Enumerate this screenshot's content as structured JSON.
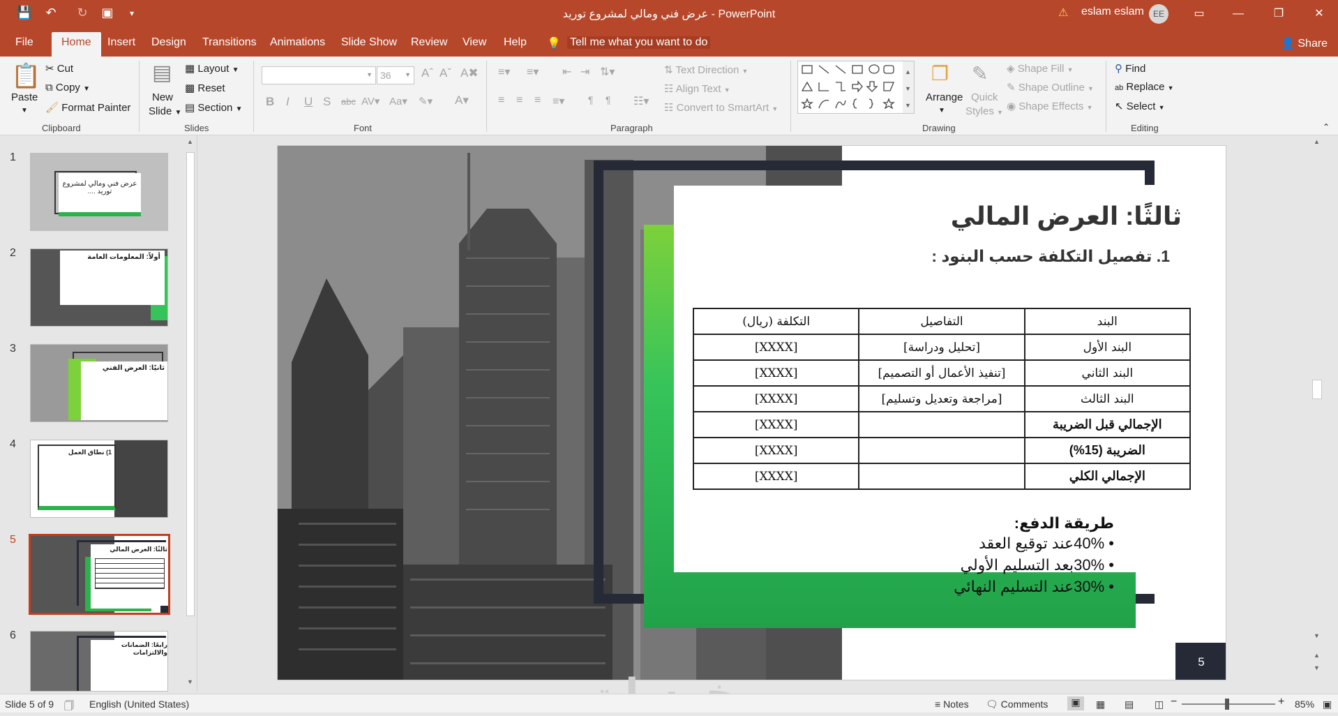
{
  "app": {
    "doc_title": "عرض فني ومالي  لمشروع توريد",
    "app_name": "PowerPoint",
    "title_separator": "-",
    "user": "eslam eslam",
    "user_initials": "EE",
    "warning": "⚠"
  },
  "menu": {
    "file": "File",
    "tabs": [
      "Home",
      "Insert",
      "Design",
      "Transitions",
      "Animations",
      "Slide Show",
      "Review",
      "View",
      "Help"
    ],
    "tell_me": "Tell me what you want to do",
    "share": "Share"
  },
  "ribbon": {
    "clipboard": {
      "paste": "Paste",
      "cut": "Cut",
      "copy": "Copy",
      "format_painter": "Format Painter",
      "label": "Clipboard"
    },
    "slides": {
      "new_slide": "New",
      "new_slide2": "Slide",
      "layout": "Layout",
      "reset": "Reset",
      "section": "Section",
      "label": "Slides"
    },
    "font": {
      "size": "36",
      "label": "Font",
      "bold": "B",
      "italic": "I",
      "underline": "U",
      "shadow": "S",
      "strike": "abc"
    },
    "paragraph": {
      "text_direction": "Text Direction",
      "align_text": "Align Text",
      "smartart": "Convert to SmartArt",
      "label": "Paragraph"
    },
    "drawing": {
      "arrange": "Arrange",
      "quick": "Quick",
      "styles": "Styles",
      "shape_fill": "Shape Fill",
      "shape_outline": "Shape Outline",
      "shape_effects": "Shape Effects",
      "label": "Drawing"
    },
    "editing": {
      "find": "Find",
      "replace": "Replace",
      "select": "Select",
      "label": "Editing"
    }
  },
  "thumbnails": {
    "numbers": [
      "1",
      "2",
      "3",
      "4",
      "5",
      "6"
    ],
    "active": 5,
    "t1_text": "عرض فني ومالي  لمشروع توريد ....",
    "t2_text": "أولاً: المعلومات العامة",
    "t3_text": "ثانيًا: العرض الفني",
    "t4_text": "1) نطاق العمل",
    "t5_text": "ثالثًا: العرض المالي",
    "t6_text": "رابعًا: الضمانات والالتزامات"
  },
  "slide": {
    "title": "ثالثًا: العرض المالي",
    "subtitle": "1. تفصيل التكلفة حسب البنود :",
    "table": {
      "headers": [
        "البند",
        "التفاصيل",
        "التكلفة (ريال)"
      ],
      "rows": [
        [
          "البند الأول",
          "[تحليل ودراسة]",
          "[XXXX]"
        ],
        [
          "البند الثاني",
          "[تنفيذ الأعمال أو التصميم]",
          "[XXXX]"
        ],
        [
          "البند الثالث",
          "[مراجعة وتعديل وتسليم]",
          "[XXXX]"
        ],
        [
          "الإجمالي قبل الضريبة",
          "",
          "[XXXX]"
        ],
        [
          "الضريبة (15%)",
          "",
          "[XXXX]"
        ],
        [
          "الإجمالي الكلي",
          "",
          "[XXXX]"
        ]
      ]
    },
    "payment_title": "طريقة الدفع:",
    "payments": [
      "40%عند توقيع العقد",
      "30%بعد التسليم الأولي",
      "30%عند التسليم النهائي"
    ],
    "number": "5"
  },
  "status": {
    "slide_of": "Slide 5 of 9",
    "language": "English (United States)",
    "notes": "Notes",
    "comments": "Comments",
    "zoom": "85%"
  },
  "watermark": "خمسات",
  "colors": {
    "accent": "#b7472a",
    "dark": "#262a36",
    "green": "#21a24a"
  }
}
